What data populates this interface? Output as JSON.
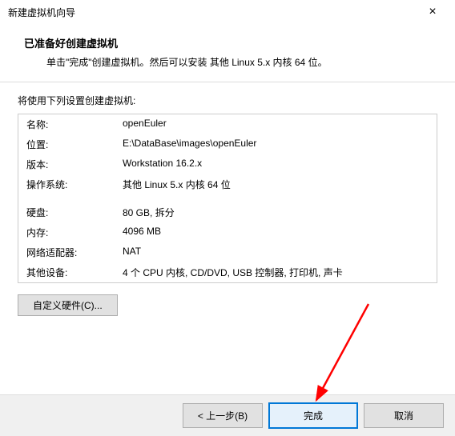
{
  "window": {
    "title": "新建虚拟机向导",
    "close_glyph": "×"
  },
  "header": {
    "heading": "已准备好创建虚拟机",
    "sub": "单击\"完成\"创建虚拟机。然后可以安装 其他 Linux 5.x 内核 64 位。"
  },
  "intro": "将使用下列设置创建虚拟机:",
  "summary": {
    "rows1": [
      {
        "key": "名称:",
        "value": "openEuler"
      },
      {
        "key": "位置:",
        "value": "E:\\DataBase\\images\\openEuler"
      },
      {
        "key": "版本:",
        "value": "Workstation 16.2.x"
      },
      {
        "key": "操作系统:",
        "value": "其他 Linux 5.x 内核 64 位"
      }
    ],
    "rows2": [
      {
        "key": "硬盘:",
        "value": "80 GB, 拆分"
      },
      {
        "key": "内存:",
        "value": "4096 MB"
      },
      {
        "key": "网络适配器:",
        "value": "NAT"
      },
      {
        "key": "其他设备:",
        "value": "4 个 CPU 内核, CD/DVD, USB 控制器, 打印机, 声卡"
      }
    ]
  },
  "buttons": {
    "customize": "自定义硬件(C)...",
    "back": "< 上一步(B)",
    "finish": "完成",
    "cancel": "取消"
  }
}
